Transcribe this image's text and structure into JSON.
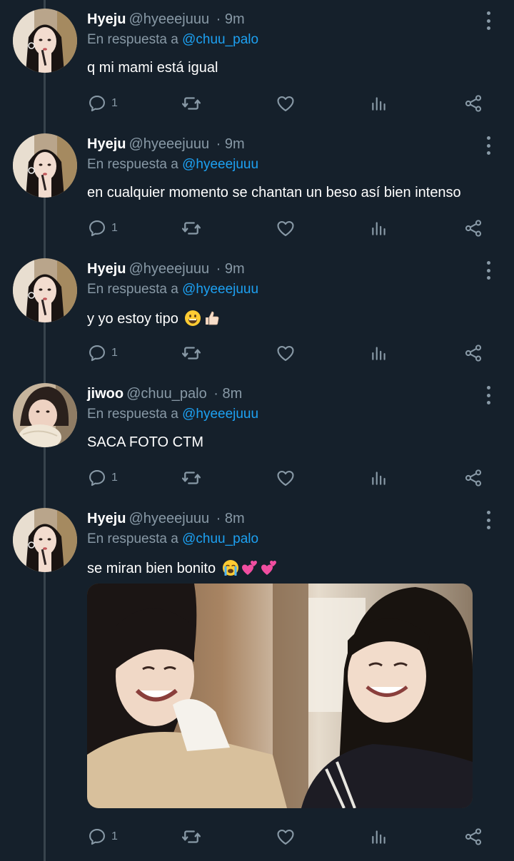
{
  "tweets": [
    {
      "author": "Hyeju",
      "handle": "@hyeeejuuu",
      "time": "· 9m",
      "reply_prefix": "En respuesta a",
      "reply_to": "@chuu_palo",
      "text": "q mi mami está igual",
      "reply_count": "1"
    },
    {
      "author": "Hyeju",
      "handle": "@hyeeejuuu",
      "time": "· 9m",
      "reply_prefix": "En respuesta a",
      "reply_to": "@hyeeejuuu",
      "text": "en cualquier momento se chantan un beso así bien intenso",
      "reply_count": "1"
    },
    {
      "author": "Hyeju",
      "handle": "@hyeeejuuu",
      "time": "· 9m",
      "reply_prefix": "En respuesta a",
      "reply_to": "@hyeeejuuu",
      "text": "y yo estoy tipo",
      "emojis": [
        "grinning-face",
        "thumbs-up"
      ],
      "reply_count": "1"
    },
    {
      "author": "jiwoo",
      "handle": "@chuu_palo",
      "time": "· 8m",
      "reply_prefix": "En respuesta a",
      "reply_to": "@hyeeejuuu",
      "text": "SACA FOTO CTM",
      "reply_count": "1"
    },
    {
      "author": "Hyeju",
      "handle": "@hyeeejuuu",
      "time": "· 8m",
      "reply_prefix": "En respuesta a",
      "reply_to": "@chuu_palo",
      "text": "se miran bien bonito",
      "emojis": [
        "crying-face",
        "two-hearts",
        "two-hearts"
      ],
      "media": "photo of two smiling women",
      "reply_count": "1"
    }
  ],
  "colors": {
    "background": "#15202b",
    "secondary_text": "#8899a6",
    "link": "#1da1f2",
    "thread_line": "#38444d"
  },
  "icons": [
    "reply-icon",
    "retweet-icon",
    "like-icon",
    "analytics-icon",
    "share-icon",
    "more-icon"
  ]
}
